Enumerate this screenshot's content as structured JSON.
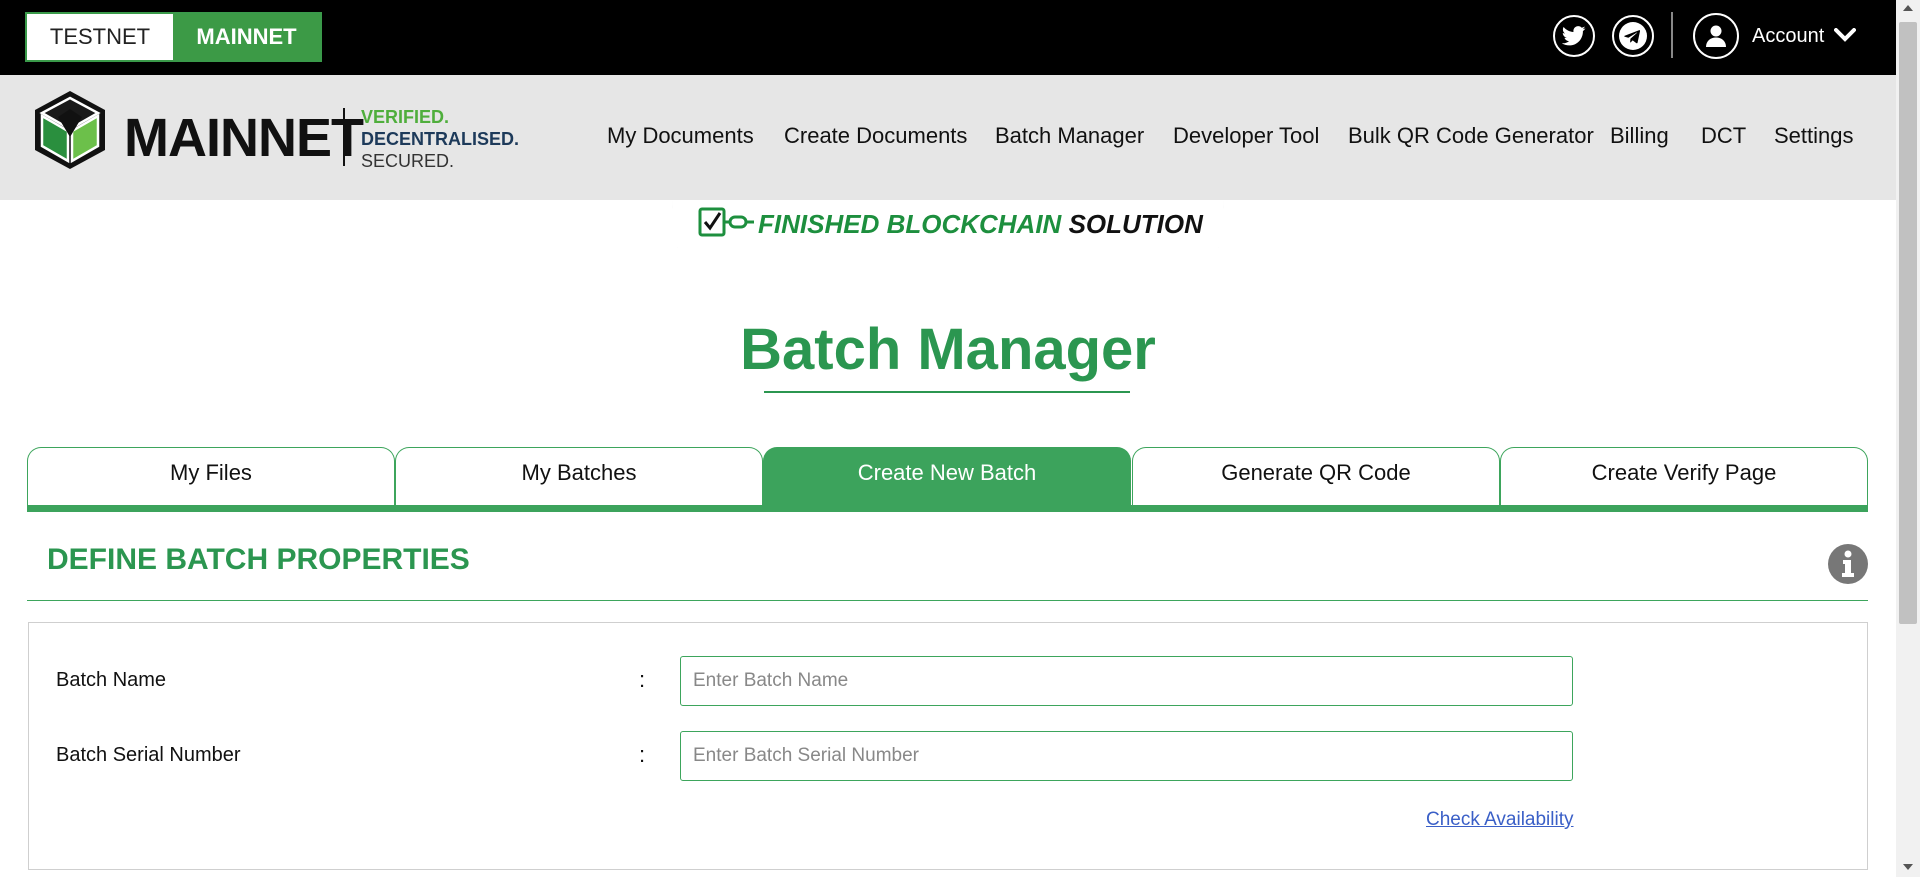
{
  "topbar": {
    "network_toggle": {
      "testnet_label": "TESTNET",
      "mainnet_label": "MAINNET",
      "selected": "MAINNET"
    },
    "social_icons": [
      "twitter-icon",
      "telegram-icon"
    ],
    "account_label": "Account"
  },
  "header": {
    "logo_text": "MAINNET",
    "tagline": {
      "line1": "VERIFIED.",
      "line2": "DECENTRALISED.",
      "line3": "SECURED."
    },
    "nav": [
      {
        "label": "My Documents"
      },
      {
        "label": "Create Documents"
      },
      {
        "label": "Batch Manager"
      },
      {
        "label": "Developer Tool"
      },
      {
        "label": "Bulk QR Code Generator"
      },
      {
        "label": "Billing"
      },
      {
        "label": "DCT"
      },
      {
        "label": "Settings"
      }
    ]
  },
  "ribbon": {
    "text_green": "FINISHED BLOCKCHAIN",
    "text_dark": "SOLUTION"
  },
  "page": {
    "title": "Batch Manager"
  },
  "tabs": [
    {
      "label": "My Files",
      "active": false
    },
    {
      "label": "My Batches",
      "active": false
    },
    {
      "label": "Create New Batch",
      "active": true
    },
    {
      "label": "Generate QR Code",
      "active": false
    },
    {
      "label": "Create Verify Page",
      "active": false
    }
  ],
  "section": {
    "title": "DEFINE BATCH PROPERTIES",
    "fields": {
      "batch_name": {
        "label": "Batch Name",
        "colon": ":",
        "value": "",
        "placeholder": "Enter Batch Name"
      },
      "batch_serial": {
        "label": "Batch Serial Number",
        "colon": ":",
        "value": "",
        "placeholder": "Enter Batch Serial Number"
      }
    },
    "check_link": "Check Availability"
  },
  "colors": {
    "brand_green": "#2b9650",
    "tab_green": "#3ca35c",
    "topbar": "#000000",
    "header_bg": "#e6e6e6"
  }
}
